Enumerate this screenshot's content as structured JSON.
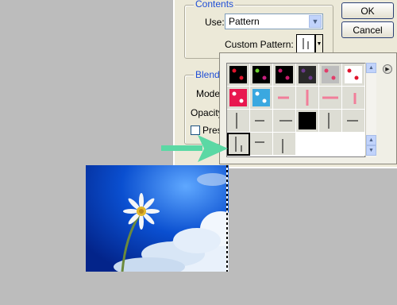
{
  "dialog": {
    "contents_legend": "Contents",
    "use_label": "Use:",
    "use_value": "Pattern",
    "custom_pattern_label": "Custom Pattern:",
    "blending_legend": "Blendi",
    "mode_label": "Mode",
    "opacity_label": "Opacity",
    "preserve_label": "Pres",
    "ok_button": "OK",
    "cancel_button": "Cancel"
  },
  "pattern_picker": {
    "selected_index": 14,
    "patterns": [
      "dots-red-black",
      "dots-green-black",
      "dots-magenta-black",
      "dots-purple-black",
      "dots-pink-gray",
      "dots-red-white",
      "dots-white-red",
      "dots-white-blue",
      "stroke-pink",
      "stroke-pink",
      "stroke-pink",
      "stroke-pink",
      "stroke-black",
      "stroke-black",
      "stroke-black",
      "solid-black",
      "stroke-black",
      "empty",
      "stroke-black",
      "stroke-black",
      "stroke-black",
      "empty",
      "empty",
      "empty"
    ]
  },
  "colors": {
    "dialog_bg": "#ece9d8",
    "legend_blue": "#1f4ed6",
    "arrow_green": "#5bd8a4",
    "sky_blue": "#0a4fd0"
  },
  "icons": {
    "dropdown": "chevron-down-icon",
    "flyout_menu": "menu-arrow-icon",
    "pointer_arrow": "arrow-right-icon"
  }
}
